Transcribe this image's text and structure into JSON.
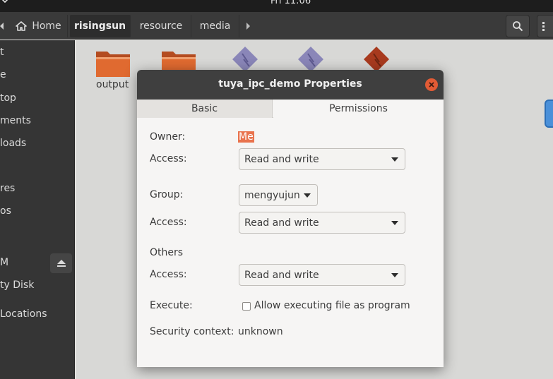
{
  "top_panel": {
    "clock": "Fri 11:06"
  },
  "toolbar": {
    "home_label": "Home",
    "crumbs": [
      "risingsun",
      "resource",
      "media"
    ]
  },
  "sidebar": {
    "items": [
      "t",
      "e",
      "top",
      "ments",
      "loads",
      "",
      "res",
      "os",
      "M",
      "ty Disk",
      "Locations"
    ]
  },
  "files": {
    "output_label": "output"
  },
  "dialog": {
    "title": "tuya_ipc_demo Properties",
    "tabs": [
      "Basic",
      "Permissions"
    ],
    "owner_label": "Owner:",
    "owner_value": "Me",
    "owner_access_label": "Access:",
    "owner_access_value": "Read and write",
    "group_label": "Group:",
    "group_value": "mengyujun",
    "group_access_label": "Access:",
    "group_access_value": "Read and write",
    "others_heading": "Others",
    "others_access_label": "Access:",
    "others_access_value": "Read and write",
    "execute_label": "Execute:",
    "execute_checkbox_label": "Allow executing file as program",
    "execute_checked": false,
    "security_label": "Security context:",
    "security_value": "unknown"
  },
  "colors": {
    "accent": "#e9734d",
    "close": "#e25b35",
    "folder": "#d9652c"
  }
}
